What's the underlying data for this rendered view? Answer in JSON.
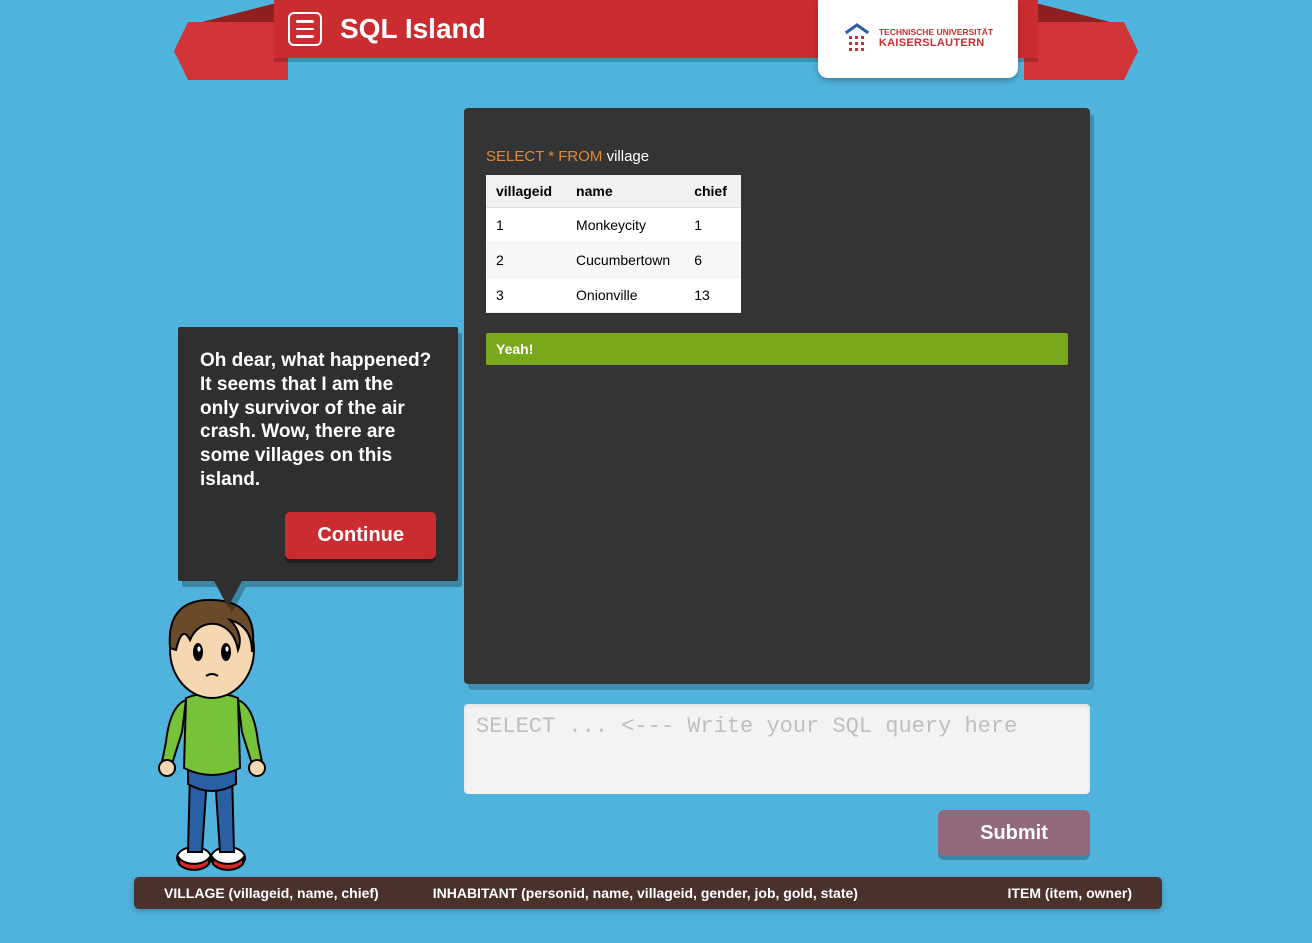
{
  "header": {
    "title": "SQL Island",
    "university_line1": "TECHNISCHE UNIVERSITÄT",
    "university_line2": "KAISERSLAUTERN"
  },
  "speech": {
    "text": "Oh dear, what happened? It seems that I am the only survivor of the air crash. Wow, there are some villages on this island.",
    "continue_label": "Continue"
  },
  "query": {
    "keywords": "SELECT * FROM",
    "rest": " village"
  },
  "table": {
    "columns": [
      "villageid",
      "name",
      "chief"
    ],
    "rows": [
      {
        "villageid": "1",
        "name": "Monkeycity",
        "chief": "1"
      },
      {
        "villageid": "2",
        "name": "Cucumbertown",
        "chief": "6"
      },
      {
        "villageid": "3",
        "name": "Onionville",
        "chief": "13"
      }
    ]
  },
  "success_message": "Yeah!",
  "sql_input": {
    "placeholder": "SELECT ... <--- Write your SQL query here"
  },
  "submit_label": "Submit",
  "schema": {
    "village": "VILLAGE (villageid, name, chief)",
    "inhabitant": "INHABITANT (personid, name, villageid, gender, job, gold, state)",
    "item": "ITEM (item, owner)"
  }
}
